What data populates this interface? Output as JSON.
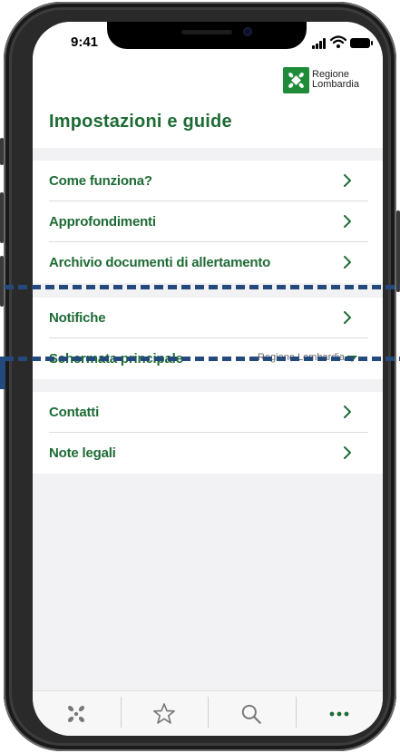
{
  "status_bar": {
    "time": "9:41"
  },
  "brand": {
    "line1": "Regione",
    "line2": "Lombardia"
  },
  "page": {
    "title": "Impostazioni e guide"
  },
  "groups": [
    {
      "items": [
        {
          "label": "Come funziona?"
        },
        {
          "label": "Approfondimenti"
        },
        {
          "label": "Archivio documenti di allertamento"
        }
      ]
    },
    {
      "items": [
        {
          "label": "Notifiche"
        },
        {
          "label": "Schermata principale",
          "value": "Regione Lombardia"
        }
      ]
    },
    {
      "items": [
        {
          "label": "Contatti"
        },
        {
          "label": "Note legali"
        }
      ]
    }
  ],
  "tabbar": {
    "tabs": [
      {
        "icon": "pinwheel-icon"
      },
      {
        "icon": "star-icon"
      },
      {
        "icon": "search-icon"
      },
      {
        "icon": "more-icon"
      }
    ]
  },
  "colors": {
    "accent": "#1e6b35",
    "brand_green": "#1f8a3a",
    "highlight": "#23497d"
  }
}
